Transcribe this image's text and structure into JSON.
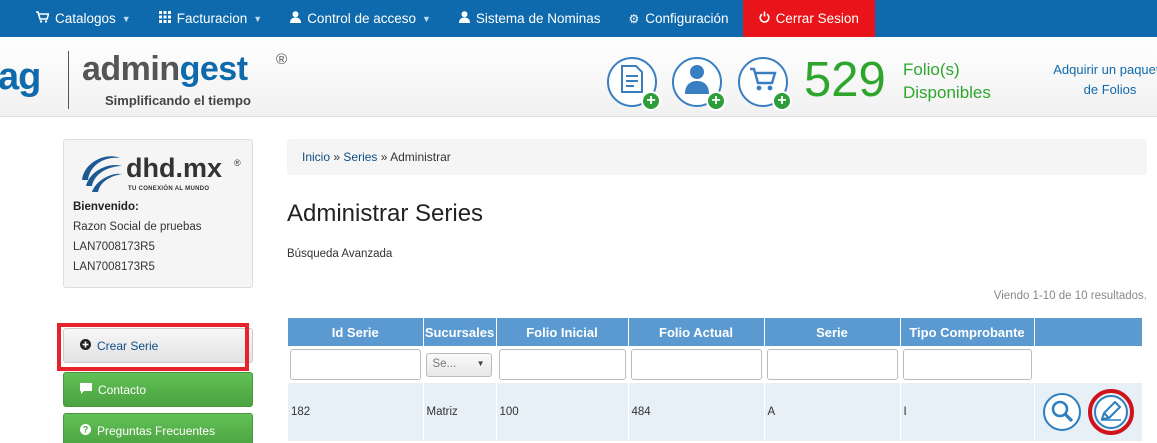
{
  "nav": {
    "items": [
      {
        "label": "Catalogos",
        "icon": "cart-icon",
        "dropdown": true
      },
      {
        "label": "Facturacion",
        "icon": "grid-icon",
        "dropdown": true
      },
      {
        "label": "Control de acceso",
        "icon": "user-icon",
        "dropdown": true
      },
      {
        "label": "Sistema de Nominas",
        "icon": "user-icon",
        "dropdown": false
      },
      {
        "label": "Configuración",
        "icon": "gear-icon",
        "dropdown": false
      }
    ],
    "logout_label": "Cerrar Sesion",
    "colors": {
      "bar": "#0e6aac",
      "logout": "#e8141a"
    }
  },
  "header": {
    "logo_fragment": "ag",
    "logo_word_a": "admin",
    "logo_word_b": "gest",
    "logo_reg": "®",
    "tagline": "Simplificando el tiempo",
    "folios_count": "529",
    "folios_label_1": "Folio(s)",
    "folios_label_2": "Disponibles",
    "acquire_1": "Adquirir un paquete",
    "acquire_2": "de Folios"
  },
  "sidebar": {
    "brand": "dhd.mx",
    "brand_reg": "®",
    "brand_tag": "TU CONEXIÓN AL MUNDO",
    "welcome": "Bienvenido:",
    "company": "Razon Social de pruebas",
    "rfc_1": "LAN7008173R5",
    "rfc_2": "LAN7008173R5",
    "buttons": {
      "create": "Crear Serie",
      "contact": "Contacto",
      "faq": "Preguntas Frecuentes"
    }
  },
  "breadcrumb": {
    "home": "Inicio",
    "sep": "»",
    "series": "Series",
    "current": "Administrar"
  },
  "main": {
    "title": "Administrar Series",
    "advanced_search": "Búsqueda Avanzada",
    "summary": "Viendo 1-10 de 10 resultados.",
    "columns": [
      "Id Serie",
      "Sucursales",
      "Folio Inicial",
      "Folio Actual",
      "Serie",
      "Tipo Comprobante",
      ""
    ],
    "sucursal_filter_placeholder": "Se...",
    "rows": [
      {
        "id": "182",
        "sucursal": "Matriz",
        "folio_inicial": "100",
        "folio_actual": "484",
        "serie": "A",
        "tipo": "I"
      }
    ]
  }
}
